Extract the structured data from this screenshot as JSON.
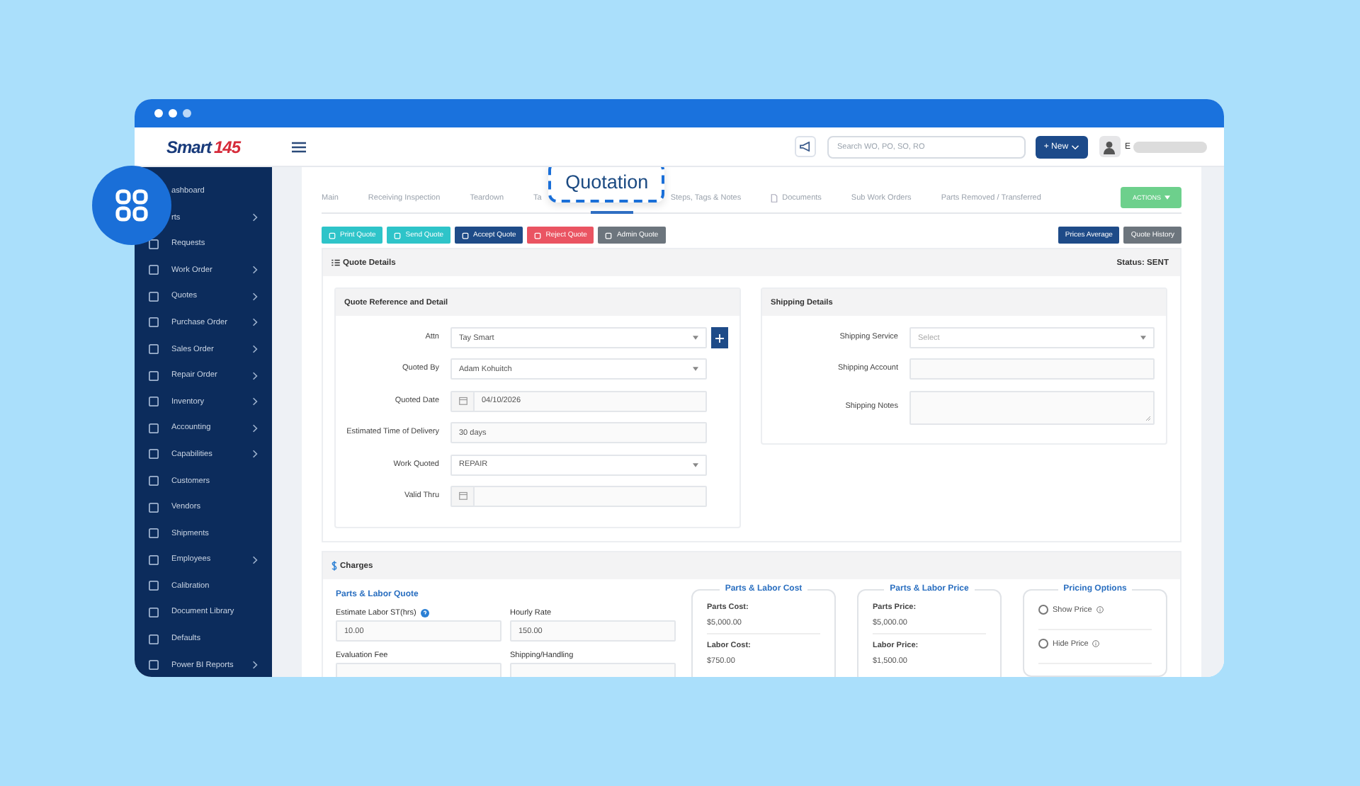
{
  "logo": {
    "word": "Smart",
    "mark": "145"
  },
  "header": {
    "search_placeholder": "Search WO, PO, SO, RO",
    "new_button": "+ New",
    "user_initial": "E"
  },
  "sidebar": {
    "items": [
      {
        "label": "ashboard",
        "submenu": false,
        "icon": false
      },
      {
        "label": "rts",
        "submenu": true,
        "icon": false
      },
      {
        "label": "Requests",
        "submenu": false,
        "icon": true
      },
      {
        "label": "Work Order",
        "submenu": true,
        "icon": true
      },
      {
        "label": "Quotes",
        "submenu": true,
        "icon": true
      },
      {
        "label": "Purchase Order",
        "submenu": true,
        "icon": true
      },
      {
        "label": "Sales Order",
        "submenu": true,
        "icon": true
      },
      {
        "label": "Repair Order",
        "submenu": true,
        "icon": true
      },
      {
        "label": "Inventory",
        "submenu": true,
        "icon": true
      },
      {
        "label": "Accounting",
        "submenu": true,
        "icon": true
      },
      {
        "label": "Capabilities",
        "submenu": true,
        "icon": true
      },
      {
        "label": "Customers",
        "submenu": false,
        "icon": true
      },
      {
        "label": "Vendors",
        "submenu": false,
        "icon": true
      },
      {
        "label": "Shipments",
        "submenu": false,
        "icon": true
      },
      {
        "label": "Employees",
        "submenu": true,
        "icon": true
      },
      {
        "label": "Calibration",
        "submenu": false,
        "icon": true
      },
      {
        "label": "Document Library",
        "submenu": false,
        "icon": true
      },
      {
        "label": "Defaults",
        "submenu": false,
        "icon": true
      },
      {
        "label": "Power BI Reports",
        "submenu": true,
        "icon": true
      }
    ]
  },
  "tabs": [
    {
      "label": "Main",
      "selected": false
    },
    {
      "label": "Receiving Inspection",
      "selected": false
    },
    {
      "label": "Teardown",
      "selected": false
    },
    {
      "label": "Ta",
      "selected": false
    },
    {
      "label": "Quotation",
      "selected": true
    },
    {
      "label": "Steps, Tags & Notes",
      "selected": false
    },
    {
      "label": "Documents",
      "selected": false,
      "icon": true
    },
    {
      "label": "Sub Work Orders",
      "selected": false
    },
    {
      "label": "Parts Removed / Transferred",
      "selected": false
    }
  ],
  "actions_button": "ACTIONS",
  "toolbar": [
    {
      "label": "Print Quote",
      "kind": "info"
    },
    {
      "label": "Send Quote",
      "kind": "info"
    },
    {
      "label": "Accept Quote",
      "kind": "primary"
    },
    {
      "label": "Reject Quote",
      "kind": "danger"
    },
    {
      "label": "Admin Quote",
      "kind": "secondary"
    }
  ],
  "toolbar_right": [
    {
      "label": "Prices Average",
      "kind": "primary"
    },
    {
      "label": "Quote History",
      "kind": "secondary"
    }
  ],
  "quote_details": {
    "title": "Quote Details",
    "status": "Status: SENT",
    "reference": {
      "title": "Quote Reference and Detail",
      "fields": [
        {
          "label": "Attn",
          "kind": "select",
          "value": "Tay Smart",
          "add": true
        },
        {
          "label": "Quoted By",
          "kind": "select",
          "value": "Adam Kohuitch"
        },
        {
          "label": "Quoted Date",
          "kind": "date",
          "value": "04/10/2026"
        },
        {
          "label": "Estimated Time of Delivery",
          "kind": "text",
          "value": "30 days"
        },
        {
          "label": "Work Quoted",
          "kind": "select",
          "value": "REPAIR"
        },
        {
          "label": "Valid Thru",
          "kind": "date"
        }
      ]
    },
    "shipping": {
      "title": "Shipping Details",
      "fields": [
        {
          "label": "Shipping Service",
          "kind": "select",
          "placeholder": "Select"
        },
        {
          "label": "Shipping Account",
          "kind": "text"
        },
        {
          "label": "Shipping Notes",
          "kind": "textarea"
        }
      ]
    }
  },
  "charges": {
    "title": "Charges",
    "quote": {
      "title": "Parts & Labor Quote",
      "fields": [
        {
          "label": "Estimate Labor ST(hrs)",
          "help": true,
          "value": "10.00"
        },
        {
          "label": "Hourly Rate",
          "value": "150.00"
        },
        {
          "label": "Evaluation Fee"
        },
        {
          "label": "Shipping/Handling"
        }
      ]
    },
    "cost": {
      "title": "Parts & Labor Cost",
      "items": [
        {
          "label": "Parts Cost:",
          "value": "$5,000.00"
        },
        {
          "label": "Labor Cost:",
          "value": "$750.00"
        }
      ]
    },
    "price": {
      "title": "Parts & Labor Price",
      "items": [
        {
          "label": "Parts Price:",
          "value": "$5,000.00"
        },
        {
          "label": "Labor Price:",
          "value": "$1,500.00"
        }
      ]
    },
    "pricing_options": {
      "title": "Pricing Options",
      "options": [
        {
          "label": "Show Price",
          "selected": false
        },
        {
          "label": "Hide Price",
          "selected": false
        }
      ]
    }
  }
}
